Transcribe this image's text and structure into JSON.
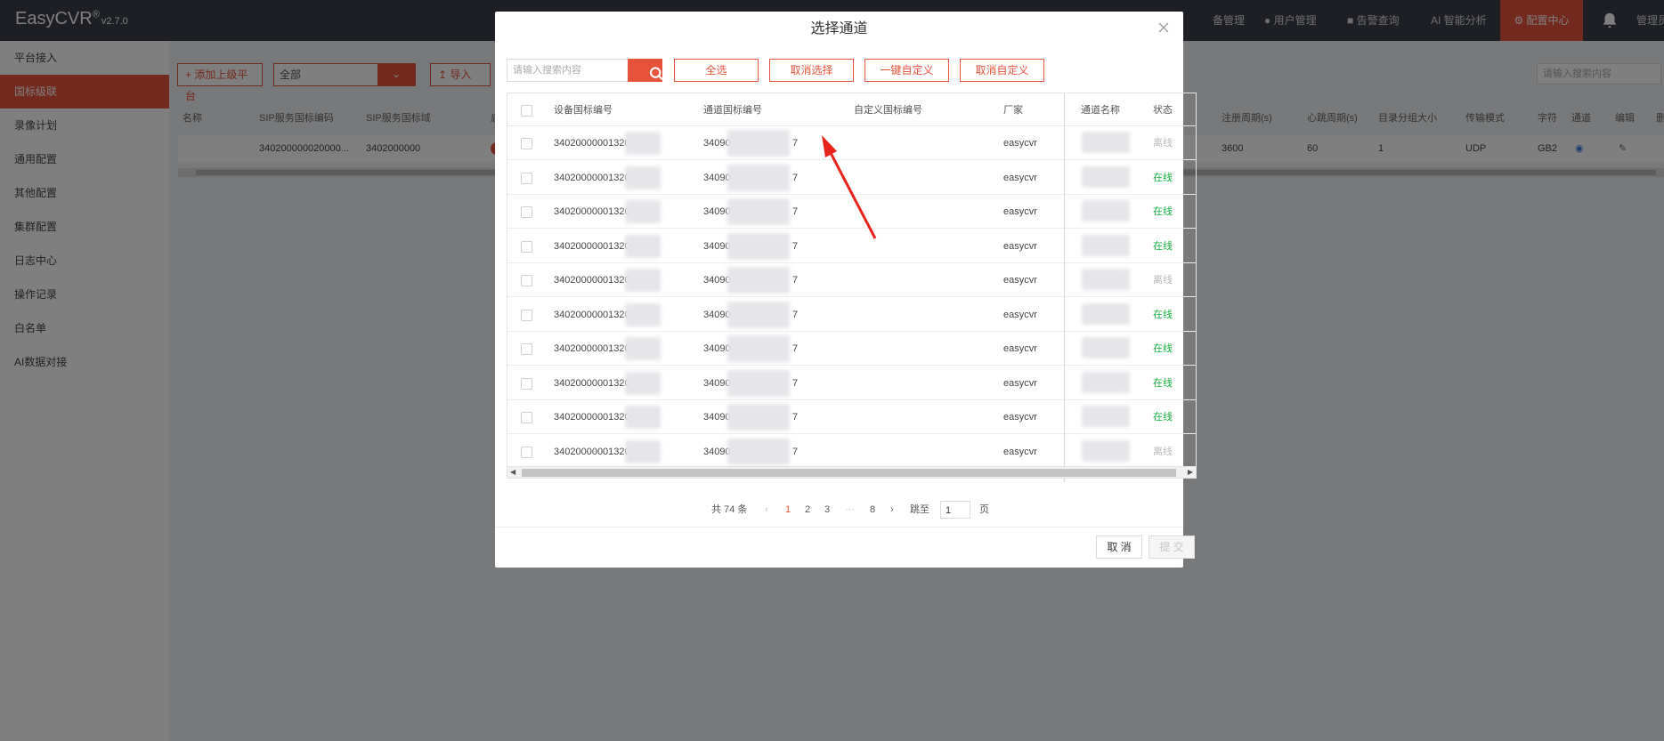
{
  "app": {
    "logo": "EasyCVR",
    "logo_mark": "®",
    "version": "v2.7.0",
    "accent": "#e6533a",
    "nav": [
      {
        "label": "备管理"
      },
      {
        "label": "用户管理"
      },
      {
        "label": "告警查询"
      },
      {
        "label": "AI 智能分析"
      },
      {
        "label": "配置中心"
      },
      {
        "label": "管理员"
      }
    ],
    "sidebar": [
      {
        "label": "平台接入"
      },
      {
        "label": "国标级联"
      },
      {
        "label": "录像计划"
      },
      {
        "label": "通用配置"
      },
      {
        "label": "其他配置"
      },
      {
        "label": "集群配置"
      },
      {
        "label": "日志中心"
      },
      {
        "label": "操作记录"
      },
      {
        "label": "白名单"
      },
      {
        "label": "AI数据对接"
      }
    ]
  },
  "page": {
    "add_button": "添加上级平台",
    "filter_value": "全部",
    "import_button": "导入",
    "search_placeholder": "请输入搜索内容",
    "columns": [
      "名称",
      "SIP服务国标编码",
      "SIP服务国标域",
      "启用",
      "注册周期(s)",
      "心跳周期(s)",
      "目录分组大小",
      "传输模式",
      "字符",
      "通道",
      "编辑",
      "删"
    ],
    "row": {
      "sip_code": "340200000020000...",
      "sip_domain": "3402000000",
      "register": "3600",
      "heartbeat": "60",
      "group_size": "1",
      "transport": "UDP",
      "charset": "GB2"
    }
  },
  "modal": {
    "title": "选择通道",
    "search_placeholder": "请输入搜索内容",
    "buttons": [
      "全选",
      "取消选择",
      "一键自定义",
      "取消自定义"
    ],
    "columns": {
      "device_code": "设备国标编号",
      "channel_code": "通道国标编号",
      "custom_code": "自定义国标编号",
      "vendor": "厂家",
      "channel_name": "通道名称",
      "status": "状态"
    },
    "rows": [
      {
        "device": "340200000013200",
        "channel_a": "34090",
        "channel_b": "7",
        "vendor": "easycvr",
        "status": "离线"
      },
      {
        "device": "340200000013200",
        "channel_a": "34090",
        "channel_b": "7",
        "vendor": "easycvr",
        "status": "在线"
      },
      {
        "device": "340200000013200",
        "channel_a": "34090",
        "channel_b": "7",
        "vendor": "easycvr",
        "status": "在线"
      },
      {
        "device": "340200000013200",
        "channel_a": "34090",
        "channel_b": "7",
        "vendor": "easycvr",
        "status": "在线"
      },
      {
        "device": "340200000013200",
        "channel_a": "34090",
        "channel_b": "7",
        "vendor": "easycvr",
        "status": "离线"
      },
      {
        "device": "340200000013200",
        "channel_a": "34090",
        "channel_b": "7",
        "vendor": "easycvr",
        "status": "在线"
      },
      {
        "device": "340200000013200",
        "channel_a": "34090",
        "channel_b": "7",
        "vendor": "easycvr",
        "status": "在线"
      },
      {
        "device": "340200000013200",
        "channel_a": "34090",
        "channel_b": "7",
        "vendor": "easycvr",
        "status": "在线"
      },
      {
        "device": "340200000013200",
        "channel_a": "34090",
        "channel_b": "7",
        "vendor": "easycvr",
        "status": "在线"
      },
      {
        "device": "340200000013200",
        "channel_a": "34090",
        "channel_b": "7",
        "vendor": "easycvr",
        "status": "离线"
      }
    ],
    "pager": {
      "total": "共 74 条",
      "pages": [
        "1",
        "2",
        "3",
        "···",
        "8"
      ],
      "current": "1",
      "goto_label": "跳至",
      "goto_value": "1",
      "page_unit": "页"
    },
    "cancel": "取 消",
    "submit": "提 交"
  }
}
